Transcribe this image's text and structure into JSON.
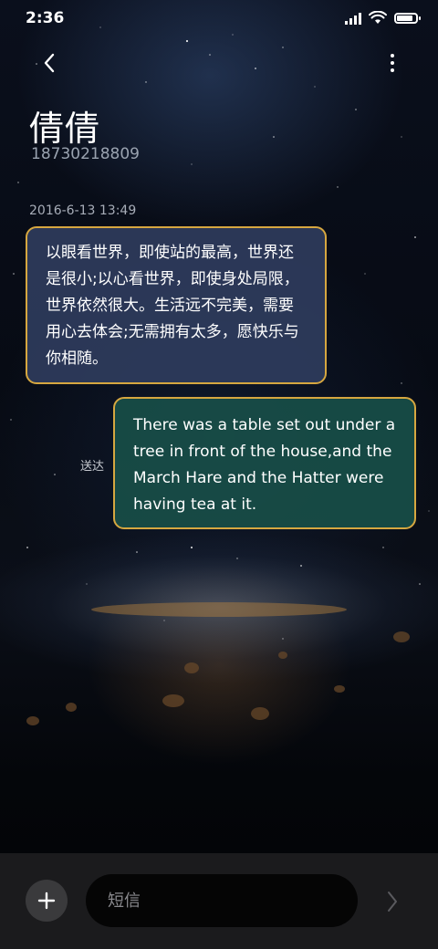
{
  "status_bar": {
    "time": "2:36",
    "icons": [
      "signal-icon",
      "wifi-icon",
      "battery-icon"
    ],
    "battery_level": 0.85
  },
  "header": {
    "back_icon": "chevron-left-icon",
    "more_icon": "more-vertical-icon",
    "contact_name": "倩倩",
    "contact_number": "18730218809"
  },
  "conversation": {
    "timestamp": "2016-6-13 13:49",
    "messages": [
      {
        "direction": "incoming",
        "text": "以眼看世界，即使站的最高，世界还是很小;以心看世界，即使身处局限，世界依然很大。生活远不完美，需要用心去体会;无需拥有太多，愿快乐与你相随。"
      },
      {
        "direction": "outgoing",
        "text": "There was a table set out under a tree in front of the house,and the March Hare and the Hatter were having tea at it.",
        "status": "送达"
      }
    ]
  },
  "composer": {
    "add_icon": "plus-icon",
    "placeholder": "短信",
    "value": "",
    "send_icon": "chevron-right-icon"
  },
  "colors": {
    "incoming_bubble": "#303e60",
    "outgoing_bubble": "#184e48",
    "bubble_border": "#d6a740",
    "bottom_bar": "#1b1b1d"
  }
}
